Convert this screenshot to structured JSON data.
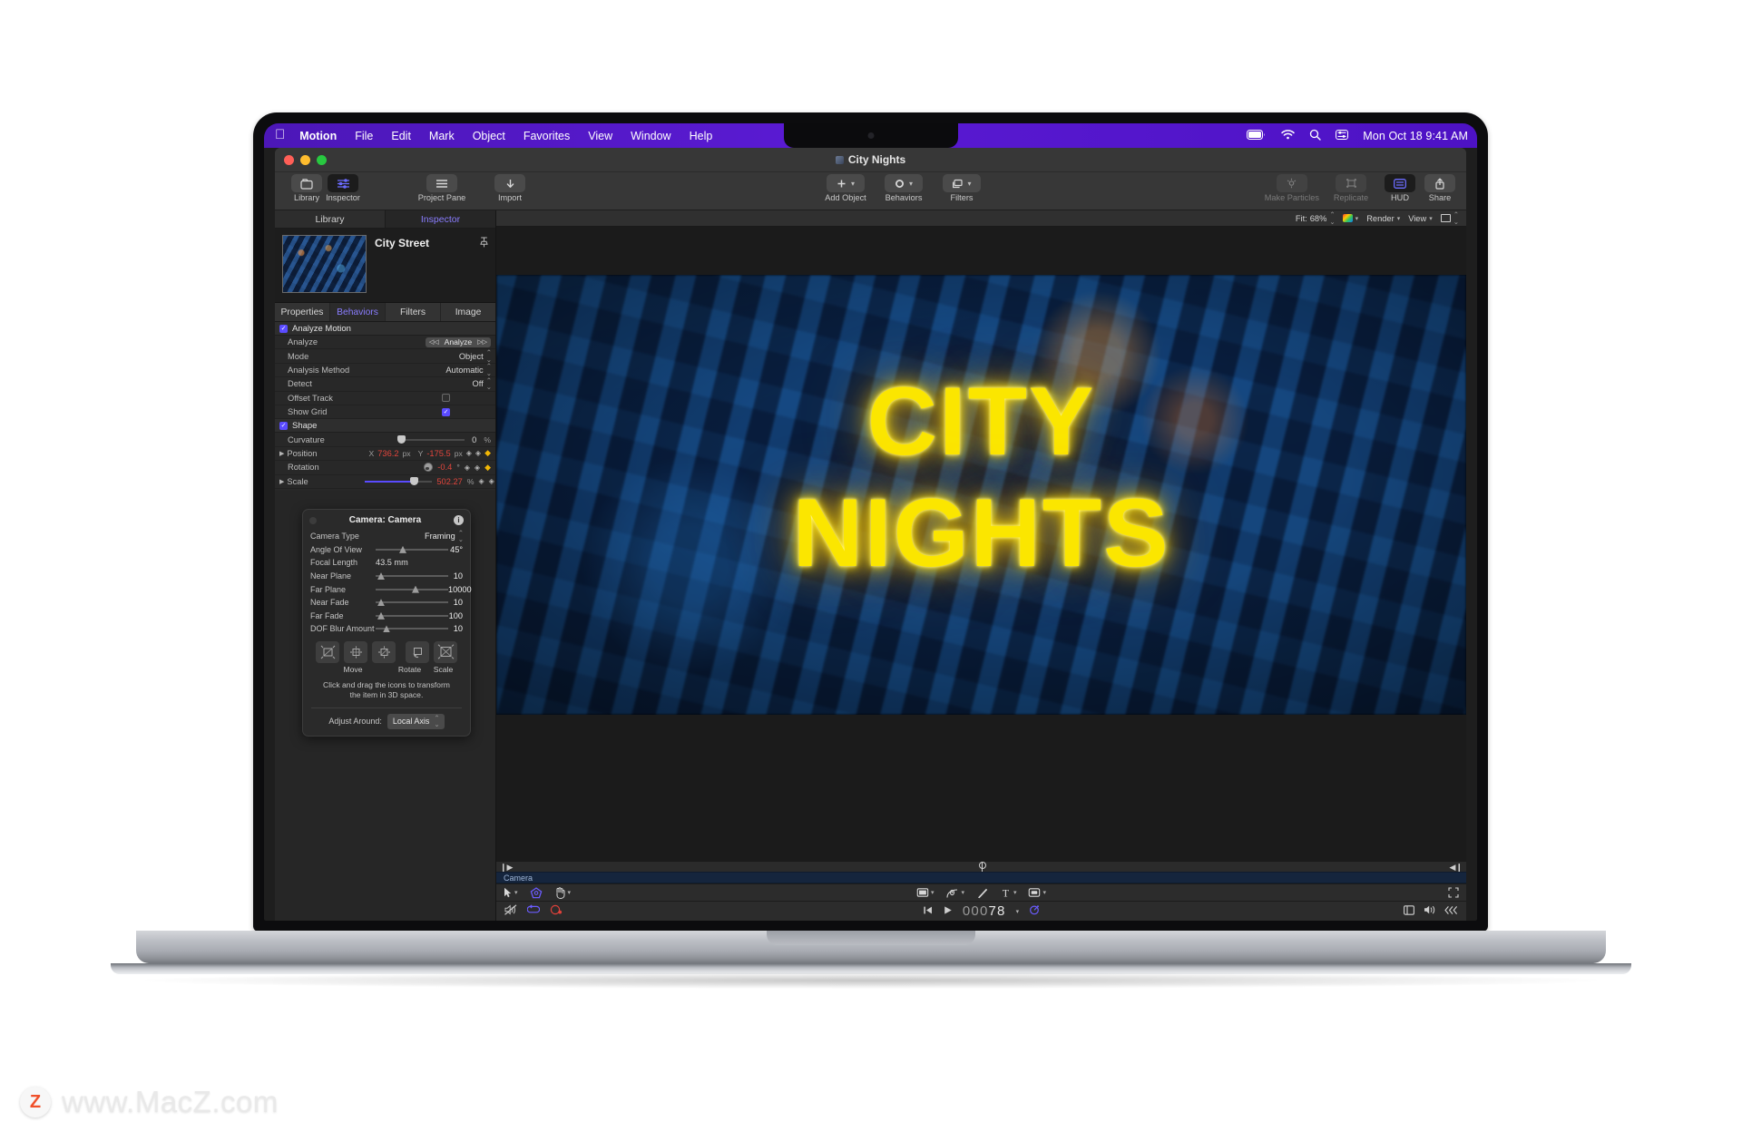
{
  "menubar": {
    "apple_icon": "apple-logo",
    "items": [
      "Motion",
      "File",
      "Edit",
      "Mark",
      "Object",
      "Favorites",
      "View",
      "Window",
      "Help"
    ],
    "status_icons": [
      "battery-icon",
      "wifi-icon",
      "search-icon",
      "control-center-icon"
    ],
    "clock": "Mon Oct 18  9:41 AM"
  },
  "window": {
    "title": "City Nights"
  },
  "toolbar": {
    "left": [
      {
        "label": "Library",
        "icon": "library-icon",
        "active": false
      },
      {
        "label": "Inspector",
        "icon": "inspector-icon",
        "active": true
      }
    ],
    "project_pane": {
      "label": "Project Pane",
      "icon": "list-icon"
    },
    "import": {
      "label": "Import",
      "icon": "download-arrow-icon"
    },
    "center": [
      {
        "label": "Add Object",
        "icon": "plus-icon"
      },
      {
        "label": "Behaviors",
        "icon": "circle-icon"
      },
      {
        "label": "Filters",
        "icon": "stack-icon"
      }
    ],
    "right": [
      {
        "label": "Make Particles",
        "icon": "particles-icon",
        "disabled": true
      },
      {
        "label": "Replicate",
        "icon": "replicate-icon",
        "disabled": true
      },
      {
        "label": "HUD",
        "icon": "hud-icon",
        "active": true
      },
      {
        "label": "Share",
        "icon": "share-icon"
      }
    ]
  },
  "sidebar": {
    "top_tabs": [
      {
        "label": "Library",
        "active": false
      },
      {
        "label": "Inspector",
        "active": true
      }
    ],
    "preview": {
      "title": "City Street",
      "pin_icon": "pin-icon"
    },
    "inspector_tabs": [
      {
        "label": "Properties",
        "active": false
      },
      {
        "label": "Behaviors",
        "active": true
      },
      {
        "label": "Filters",
        "active": false
      },
      {
        "label": "Image",
        "active": false
      }
    ],
    "groups": [
      {
        "title": "Analyze Motion",
        "checked": true,
        "rows": [
          {
            "name": "Analyze",
            "type": "button",
            "value": "Analyze",
            "prev_icon": "step-back-icon",
            "next_icon": "step-forward-icon"
          },
          {
            "name": "Mode",
            "type": "popup",
            "value": "Object"
          },
          {
            "name": "Analysis Method",
            "type": "popup",
            "value": "Automatic"
          },
          {
            "name": "Detect",
            "type": "popup",
            "value": "Off"
          },
          {
            "name": "Offset Track",
            "type": "checkbox",
            "checked": false
          },
          {
            "name": "Show Grid",
            "type": "checkbox",
            "checked": true
          }
        ]
      },
      {
        "title": "Shape",
        "checked": true,
        "rows": [
          {
            "name": "Curvature",
            "type": "slider",
            "value": "0",
            "unit": "%",
            "fill_pct": 0
          },
          {
            "name": "Position",
            "type": "xy",
            "x_label": "X",
            "x_value": "736.2",
            "x_unit": "px",
            "y_label": "Y",
            "y_value": "-175.5",
            "y_unit": "px",
            "disclosure": true,
            "keyframe": true
          },
          {
            "name": "Rotation",
            "type": "dial",
            "value": "-0.4",
            "unit": "°",
            "keyframe": true
          },
          {
            "name": "Scale",
            "type": "slider",
            "value": "502.27",
            "unit": "%",
            "fill_pct": 72,
            "disclosure": true,
            "keyframe": true
          }
        ]
      }
    ]
  },
  "hud": {
    "title": "Camera: Camera",
    "info_icon": "info-icon",
    "rows": [
      {
        "name": "Camera Type",
        "kind": "popup",
        "value": "Framing"
      },
      {
        "name": "Angle Of View",
        "kind": "slider",
        "value": "45°",
        "knob_pct": 30
      },
      {
        "name": "Focal Length",
        "kind": "text",
        "value": "43.5 mm"
      },
      {
        "name": "Near Plane",
        "kind": "slider",
        "value": "10",
        "knob_pct": 3
      },
      {
        "name": "Far Plane",
        "kind": "slider",
        "value": "10000",
        "knob_pct": 50
      },
      {
        "name": "Near Fade",
        "kind": "slider",
        "value": "10",
        "knob_pct": 3
      },
      {
        "name": "Far Fade",
        "kind": "slider",
        "value": "100",
        "knob_pct": 3
      },
      {
        "name": "DOF Blur Amount",
        "kind": "slider",
        "value": "10",
        "knob_pct": 12
      }
    ],
    "transform_labels": {
      "move": "Move",
      "rotate": "Rotate",
      "scale": "Scale"
    },
    "hint_line1": "Click and drag the icons to transform",
    "hint_line2": "the item in 3D space.",
    "adjust_label": "Adjust Around:",
    "adjust_value": "Local Axis"
  },
  "canvas_bar": {
    "fit_label": "Fit:",
    "zoom": "68%",
    "render_label": "Render",
    "view_label": "View"
  },
  "canvas": {
    "neon_line1": "CITY",
    "neon_line2": "NIGHTS",
    "neon_color": "#fbe600",
    "background_description": "aerial-city-night-photo"
  },
  "timeline": {
    "track_name": "Camera",
    "in_icon": "in-point-icon",
    "out_icon": "out-point-icon",
    "playhead_icon": "playhead-icon"
  },
  "toolstrip": {
    "left_icons": [
      "select-arrow-icon",
      "chevron-down-icon",
      "transform-3d-icon",
      "pan-hand-icon",
      "chevron-down-icon"
    ],
    "center_icons": [
      "rectangle-mask-icon",
      "chevron-down-icon",
      "bezier-pen-icon",
      "chevron-down-icon",
      "paint-stroke-icon",
      "text-tool-icon",
      "chevron-down-icon",
      "shape-tool-icon",
      "chevron-down-icon"
    ],
    "right_icons": [
      "fullscreen-icon"
    ]
  },
  "transport": {
    "mute_icon": "mute-icon",
    "loop_icon": "loop-icon",
    "record_icon": "record-icon",
    "goto_start_icon": "go-to-start-icon",
    "play_icon": "play-icon",
    "timecode_dim": "000",
    "timecode_bright": "78",
    "timecode_chevron": "chevron-down-icon",
    "keyframe_record_icon": "keyframe-record-icon",
    "right_icons": [
      "timeline-toggle-icon",
      "audio-icon",
      "keying-icon"
    ]
  },
  "watermark": {
    "badge": "Z",
    "text": "www.MacZ.com"
  }
}
